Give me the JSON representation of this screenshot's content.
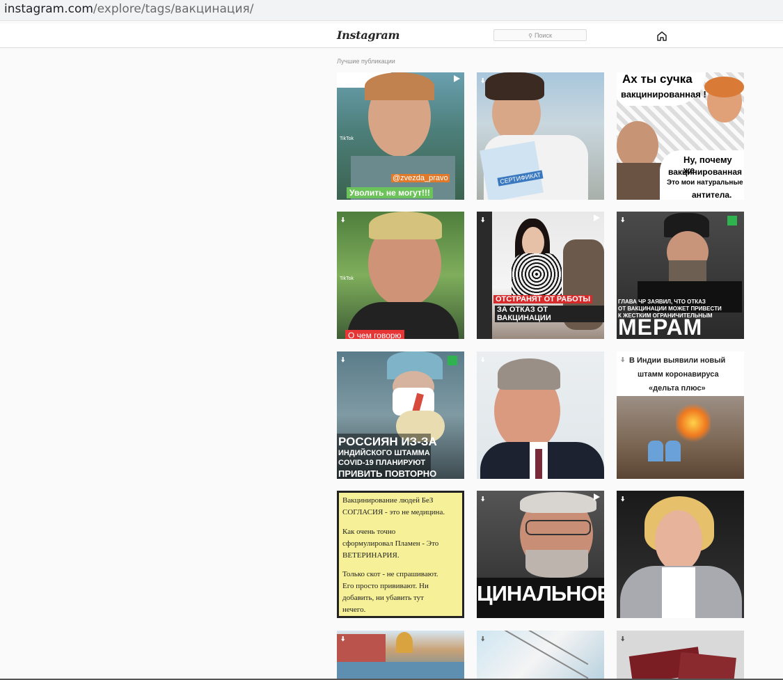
{
  "browser": {
    "url_host": "instagram.com",
    "url_path": "/explore/tags/вакцинация/"
  },
  "nav": {
    "logo": "Instagram",
    "search_placeholder": "Поиск"
  },
  "section_title": "Лучшие публикации",
  "posts": [
    {
      "lines": [
        "@zvezda_pravo",
        "Уволить не могут!!!"
      ],
      "tiktok": "TikTok"
    },
    {
      "lines": [
        "СЕРТИФИКАТ"
      ]
    },
    {
      "lines": [
        "Ах ты сучка",
        "вакцинированная !",
        "Ну, почему же",
        "вакцинированная",
        "Это мои натуральные",
        "антитела."
      ]
    },
    {
      "lines": [
        "TikTok",
        "О чем говорю"
      ]
    },
    {
      "lines": [
        "ОТСТРАНЯТ ОТ РАБОТЫ",
        "ЗА ОТКАЗ ОТ ВАКЦИНАЦИИ"
      ]
    },
    {
      "lines": [
        "ГЛАВА ЧР ЗАЯВИЛ, ЧТО ОТКАЗ",
        "ОТ ВАКЦИНАЦИИ МОЖЕТ ПРИВЕСТИ",
        "К ЖЕСТКИМ ОГРАНИЧИТЕЛЬНЫМ",
        "МЕРАМ"
      ]
    },
    {
      "lines": [
        "РОССИЯН ИЗ-ЗА",
        "ИНДИЙСКОГО ШТАММА",
        "COVID-19 ПЛАНИРУЮТ",
        "ПРИВИТЬ ПОВТОРНО"
      ]
    },
    {
      "lines": []
    },
    {
      "lines": [
        "В Индии выявили новый",
        "штамм коронавируса",
        "«дельта плюс»"
      ]
    },
    {
      "lines": [
        "Вакцинирование людей БеЗ",
        "СОГЛАСИЯ - это не медицина.",
        "Как очень точно",
        "сформулировал Пламен - Это",
        "ВЕТЕРИНАРИЯ.",
        "Только скот - не спрашивают.",
        "Его просто прививают. Ни",
        "добавить, ни убавить тут",
        "нечего."
      ]
    },
    {
      "lines": [
        "ЦИНАЛЬНОЕ ЛО"
      ]
    },
    {
      "lines": []
    },
    {
      "lines": []
    },
    {
      "lines": []
    },
    {
      "lines": []
    }
  ]
}
